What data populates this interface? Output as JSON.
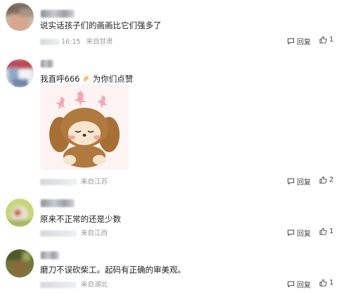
{
  "comments": [
    {
      "text": "说实话孩子们的画画比它们强多了",
      "time": "16:15",
      "location": "来自甘肃",
      "reply_label": "回复",
      "like_count": "1"
    },
    {
      "text": "我直呼666",
      "text_suffix": "为你们点赞",
      "location": "来自江苏",
      "reply_label": "回复",
      "like_count": "2"
    },
    {
      "text": "原来不正常的还是少数",
      "location": "来自江西",
      "reply_label": "回复",
      "like_count": "1"
    },
    {
      "text": "磨刀不误砍柴工。起码有正确的审美观。",
      "location": "来自湖北",
      "reply_label": "回复",
      "like_count": "1"
    }
  ],
  "icons": {
    "reply": "chat-bubble-icon",
    "like": "thumbs-up-icon",
    "clap": "clap-emoji-icon",
    "sticker": "puppy-sticker"
  },
  "colors": {
    "meta_text": "#9a9a9a",
    "sticker_dog": "#b07a3e",
    "sticker_bg": "#fdf3f3"
  }
}
